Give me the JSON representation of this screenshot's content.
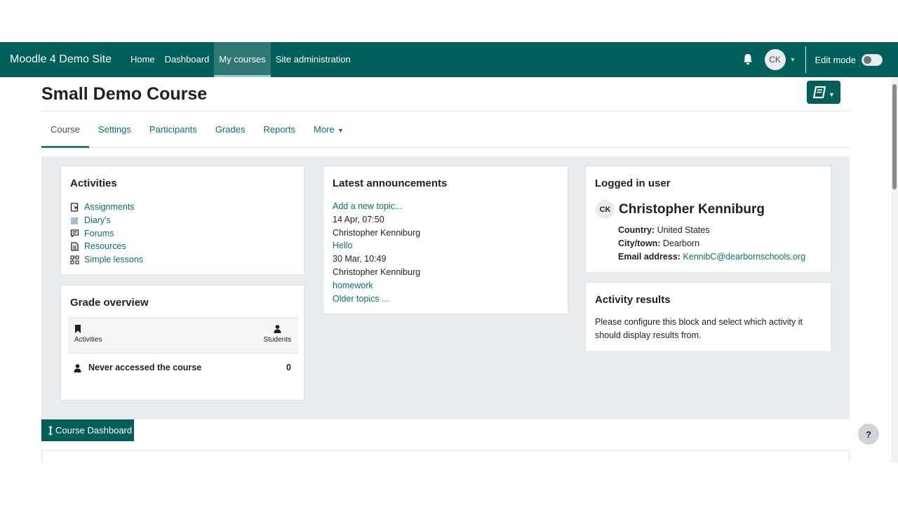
{
  "navbar": {
    "brand": "Moodle 4 Demo Site",
    "links": [
      {
        "label": "Home",
        "active": false
      },
      {
        "label": "Dashboard",
        "active": false
      },
      {
        "label": "My courses",
        "active": true
      },
      {
        "label": "Site administration",
        "active": false
      }
    ],
    "avatar_initials": "CK",
    "edit_mode_label": "Edit mode",
    "edit_mode_on": false
  },
  "course": {
    "title": "Small Demo Course"
  },
  "secondary_nav": {
    "tabs": [
      {
        "label": "Course",
        "active": true
      },
      {
        "label": "Settings",
        "active": false
      },
      {
        "label": "Participants",
        "active": false
      },
      {
        "label": "Grades",
        "active": false
      },
      {
        "label": "Reports",
        "active": false
      },
      {
        "label": "More",
        "active": false
      }
    ]
  },
  "activities": {
    "title": "Activities",
    "items": [
      {
        "label": "Assignments",
        "icon": "assignment-icon"
      },
      {
        "label": "Diary's",
        "icon": "diary-icon"
      },
      {
        "label": "Forums",
        "icon": "forum-icon"
      },
      {
        "label": "Resources",
        "icon": "resource-icon"
      },
      {
        "label": "Simple lessons",
        "icon": "lesson-icon"
      }
    ]
  },
  "grade_overview": {
    "title": "Grade overview",
    "col_activities": "Activities",
    "col_students": "Students",
    "row_label": "Never accessed the course",
    "row_count": "0"
  },
  "announcements": {
    "title": "Latest announcements",
    "add_topic": "Add a new topic...",
    "posts": [
      {
        "date": "14 Apr, 07:50",
        "author": "Christopher Kenniburg",
        "subject": "Hello"
      },
      {
        "date": "30 Mar, 10:49",
        "author": "Christopher Kenniburg",
        "subject": "homework"
      }
    ],
    "older": "Older topics ..."
  },
  "logged_in_user": {
    "title": "Logged in user",
    "initials": "CK",
    "name": "Christopher Kenniburg",
    "country_label": "Country:",
    "country": "United States",
    "city_label": "City/town:",
    "city": "Dearborn",
    "email_label": "Email address:",
    "email": "KennibC@dearbornschools.org"
  },
  "activity_results": {
    "title": "Activity results",
    "text_line1": "Please configure this block and select which activity it",
    "text_line2": "should display results from."
  },
  "course_dashboard_label": "Course Dashboard",
  "help_label": "?",
  "colors": {
    "brand": "#025e5a",
    "link": "#0f6d6a",
    "block_region_bg": "#e9ecef"
  }
}
